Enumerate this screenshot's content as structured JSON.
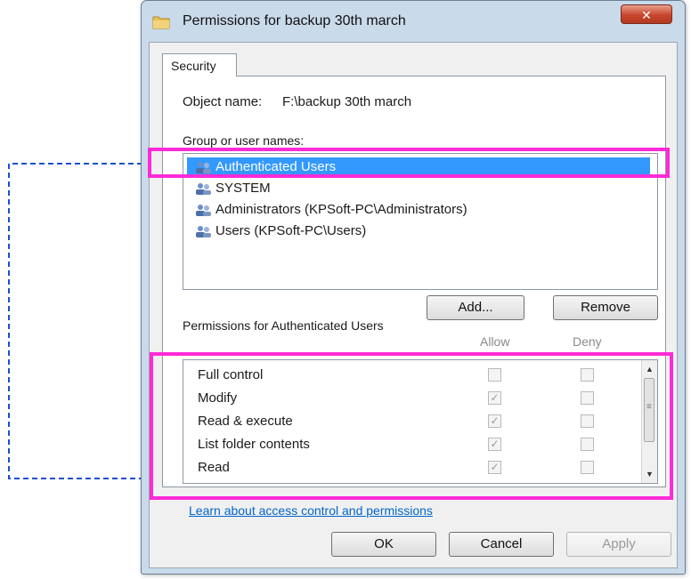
{
  "window": {
    "title": "Permissions for backup 30th march",
    "close_glyph": "✕"
  },
  "tabs": [
    {
      "label": "Security"
    }
  ],
  "object": {
    "label": "Object name:",
    "value": "F:\\backup 30th march"
  },
  "groups": {
    "label": "Group or user names:",
    "users": [
      {
        "name": "Authenticated Users",
        "icon": "users-icon",
        "selected": true
      },
      {
        "name": "SYSTEM",
        "icon": "users-icon",
        "selected": false
      },
      {
        "name": "Administrators (KPSoft-PC\\Administrators)",
        "icon": "users-icon",
        "selected": false
      },
      {
        "name": "Users (KPSoft-PC\\Users)",
        "icon": "users-icon",
        "selected": false
      }
    ],
    "add_label": "Add...",
    "remove_label": "Remove"
  },
  "permissions": {
    "label": "Permissions for Authenticated Users",
    "allow_header": "Allow",
    "deny_header": "Deny",
    "rows": [
      {
        "name": "Full control",
        "allow": false,
        "deny": false
      },
      {
        "name": "Modify",
        "allow": true,
        "deny": false
      },
      {
        "name": "Read & execute",
        "allow": true,
        "deny": false
      },
      {
        "name": "List folder contents",
        "allow": true,
        "deny": false
      },
      {
        "name": "Read",
        "allow": true,
        "deny": false
      }
    ]
  },
  "link": {
    "label": "Learn about access control and permissions"
  },
  "buttons": {
    "ok_label": "OK",
    "cancel_label": "Cancel",
    "apply_label": "Apply"
  },
  "annotation": {
    "highlight_color": "#ff2ad8",
    "arrow_color": "#1a4fd0"
  }
}
